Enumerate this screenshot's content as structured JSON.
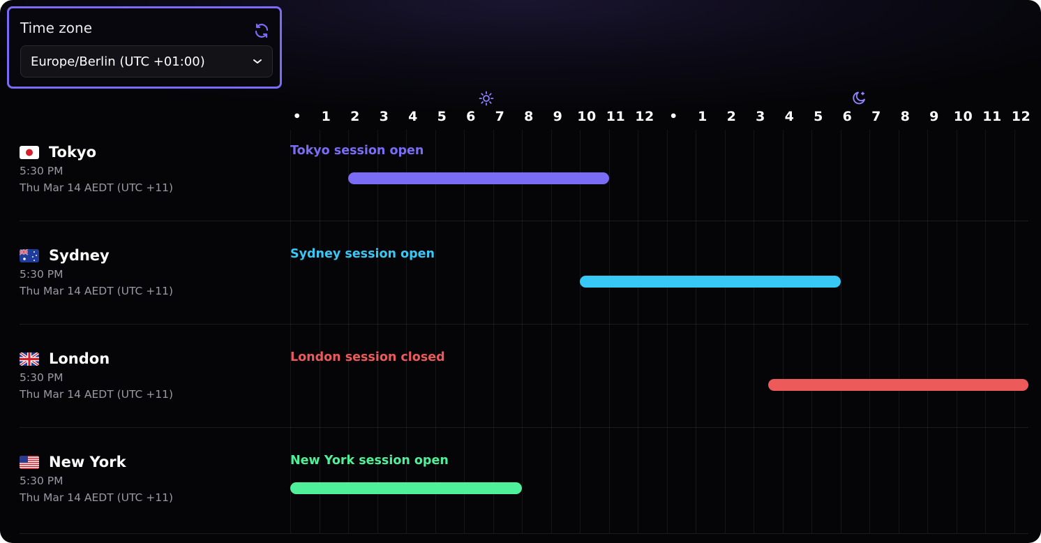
{
  "timezone": {
    "label": "Time zone",
    "selected": "Europe/Berlin (UTC +01:00)"
  },
  "hours": [
    "•",
    "1",
    "2",
    "3",
    "4",
    "5",
    "6",
    "7",
    "8",
    "9",
    "10",
    "11",
    "12",
    "•",
    "1",
    "2",
    "3",
    "4",
    "5",
    "6",
    "7",
    "8",
    "9",
    "10",
    "11",
    "12"
  ],
  "markers": {
    "day_icon": "sun-icon",
    "night_icon": "moon-icon"
  },
  "colors": {
    "tokyo": "#7b6cf6",
    "sydney": "#38c8f5",
    "london": "#ec5a5a",
    "newyork": "#4ff09a",
    "accent": "#7b6cf6"
  },
  "cities": [
    {
      "name": "Tokyo",
      "flag": "japan-flag-icon",
      "time": "5:30 PM",
      "date": "Thu Mar 14 AEDT (UTC +11)",
      "status": "Tokyo session open",
      "session_start_hour": 2,
      "session_end_hour": 11
    },
    {
      "name": "Sydney",
      "flag": "australia-flag-icon",
      "time": "5:30 PM",
      "date": "Thu Mar 14 AEDT (UTC +11)",
      "status": "Sydney session open",
      "session_start_hour": 10,
      "session_end_hour": 19
    },
    {
      "name": "London",
      "flag": "uk-flag-icon",
      "time": "5:30 PM",
      "date": "Thu Mar 14 AEDT (UTC +11)",
      "status": "London session closed",
      "session_start_hour": 16.5,
      "session_end_hour": 25.5
    },
    {
      "name": "New York",
      "flag": "usa-flag-icon",
      "time": "5:30 PM",
      "date": "Thu Mar 14 AEDT (UTC +11)",
      "status": "New York session open",
      "session_start_hour": 0,
      "session_end_hour": 8
    }
  ]
}
